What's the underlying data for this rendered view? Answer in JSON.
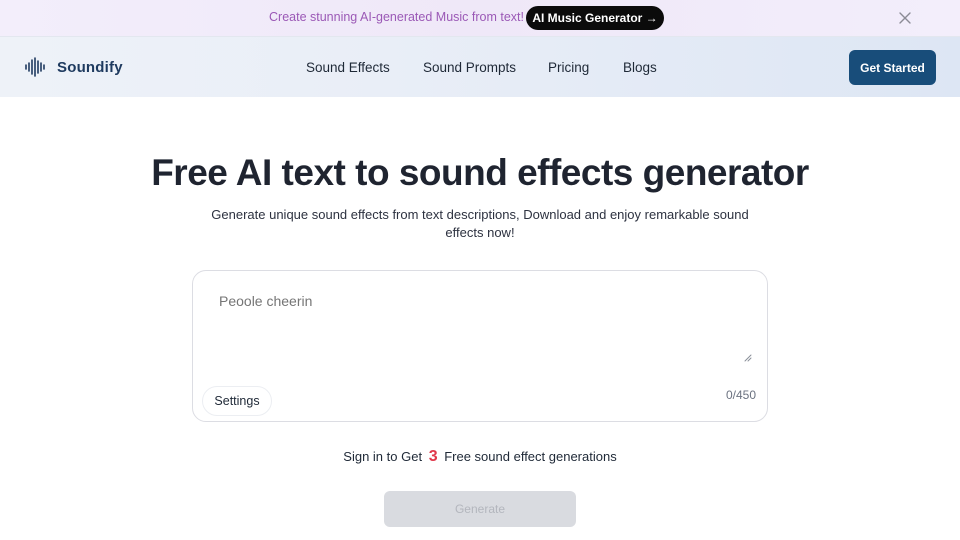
{
  "promo": {
    "text": "Create stunning AI-generated Music from text!",
    "button_label": "AI Music Generator →"
  },
  "nav": {
    "brand": "Soundify",
    "links": [
      "Sound Effects",
      "Sound Prompts",
      "Pricing",
      "Blogs"
    ],
    "cta_label": "Get Started"
  },
  "hero": {
    "title": "Free AI text to sound effects generator",
    "subtitle": "Generate unique sound effects from text descriptions, Download and enjoy remarkable sound effects now!"
  },
  "prompt_box": {
    "placeholder": "Peoole cheerin",
    "value": "",
    "settings_label": "Settings",
    "counter": "0/450"
  },
  "signin": {
    "prefix": "Sign in to Get",
    "count": "3",
    "suffix": "Free sound effect generations"
  },
  "generate_label": "Generate",
  "colors": {
    "accent": "#184d7a",
    "promo_text": "#9b59b6",
    "highlight": "#e0384a"
  }
}
